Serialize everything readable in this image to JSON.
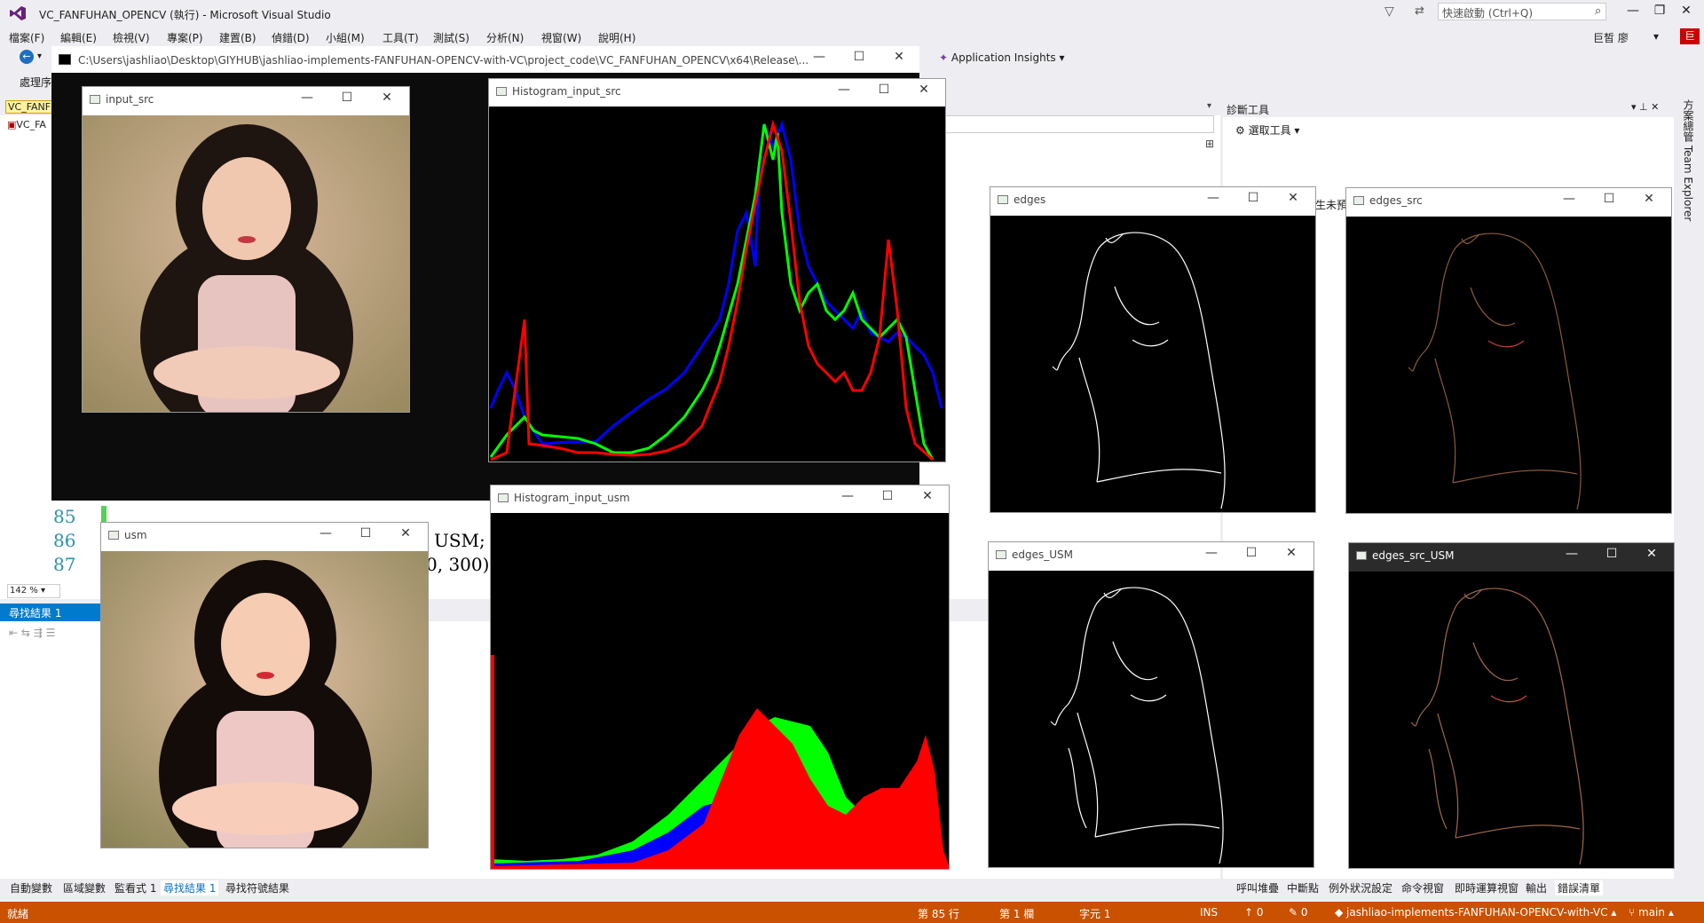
{
  "window": {
    "title": "VC_FANFUHAN_OPENCV (執行) - Microsoft Visual Studio",
    "quick_launch_placeholder": "快速啟動 (Ctrl+Q)",
    "user": "巨皙 廖",
    "avatar_initial": "巨"
  },
  "menu": [
    "檔案(F)",
    "編輯(E)",
    "檢視(V)",
    "專案(P)",
    "建置(B)",
    "偵錯(D)",
    "小組(M)",
    "工具(T)",
    "測試(S)",
    "分析(N)",
    "視窗(W)",
    "說明(H)"
  ],
  "toolbar": {
    "app_insights": "Application Insights",
    "process_label": "處理序"
  },
  "editor": {
    "doc_tab": "VC_FANF",
    "doc_tab2": "VC_FA",
    "lines": [
      {
        "num": "85",
        "code": ""
      },
      {
        "num": "86",
        "code": "USM;"
      },
      {
        "num": "87",
        "code": "0, 300)"
      }
    ],
    "zoom": "142 %"
  },
  "console": {
    "title": "C:\\Users\\jashliao\\Desktop\\GIYHUB\\jashliao-implements-FANFUHAN-OPENCV-with-VC\\project_code\\VC_FANFUHAN_OPENCV\\x64\\Release\\..."
  },
  "cv_windows": {
    "input_src": "input_src",
    "histogram_input_src": "Histogram_input_src",
    "histogram_input_usm": "Histogram_input_usm",
    "usm": "usm",
    "edges": "edges",
    "edges_src": "edges_src",
    "edges_usm": "edges_USM",
    "edges_src_usm": "edges_src_USM"
  },
  "panels": {
    "find_results_title": "尋找結果 1",
    "diag_title": "診斷工具",
    "diag_select": "選取工具",
    "diag_cut_text": "生未預",
    "side_strip": "方案總管  Team Explorer"
  },
  "bottom_tabs": [
    "自動變數",
    "區域變數",
    "監看式 1",
    "尋找結果 1",
    "尋找符號結果"
  ],
  "right_tabs": [
    "呼叫堆疊",
    "中斷點",
    "例外狀況設定",
    "命令視窗",
    "即時運算視窗",
    "輸出",
    "錯誤清單"
  ],
  "statusbar": {
    "ready": "就緒",
    "line": "第 85 行",
    "col": "第 1 欄",
    "char": "字元 1",
    "ins": "INS",
    "up_count": "0",
    "edit_count": "0",
    "repo": "jashliao-implements-FANFUHAN-OPENCV-with-VC",
    "branch": "main"
  },
  "colors": {
    "status_bar": "#ca5100",
    "hist_blue": "#0000ff",
    "hist_green": "#00ff00",
    "hist_red": "#ff0000"
  }
}
